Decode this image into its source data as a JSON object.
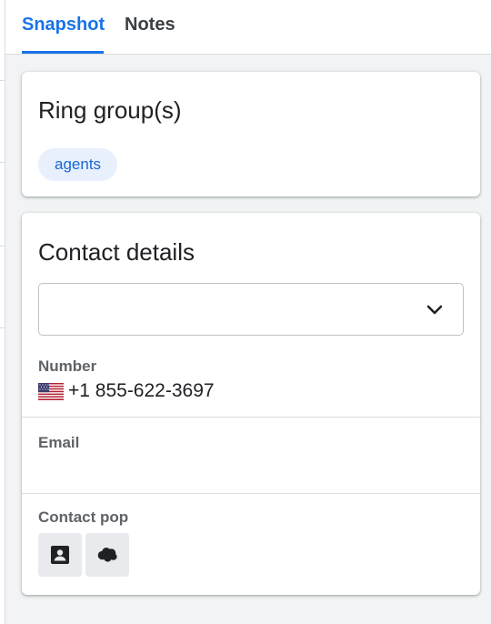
{
  "tabs": [
    {
      "label": "Snapshot",
      "active": true
    },
    {
      "label": "Notes",
      "active": false
    }
  ],
  "ring_groups": {
    "title": "Ring group(s)",
    "chips": [
      "agents"
    ]
  },
  "contact_details": {
    "title": "Contact details",
    "select_value": "",
    "number_label": "Number",
    "number_flag": "us-flag-icon",
    "number_value": "+1 855-622-3697",
    "email_label": "Email",
    "email_value": "",
    "contact_pop_label": "Contact pop",
    "contact_pop_buttons": [
      "contact-card-icon",
      "salesforce-cloud-icon"
    ]
  },
  "colors": {
    "accent": "#1a73e8",
    "chip_bg": "#e8f0fe",
    "chip_text": "#1967d2",
    "page_bg": "#f1f3f4"
  }
}
